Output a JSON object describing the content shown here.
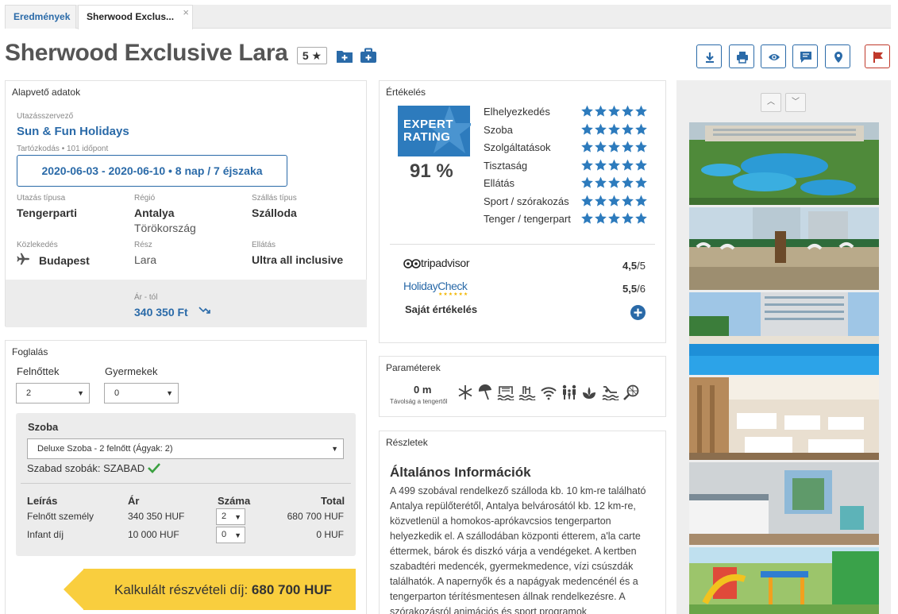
{
  "tabs": [
    {
      "label": "Eredmények",
      "active": false
    },
    {
      "label": "Sherwood Exclus...",
      "active": true,
      "close": "×"
    }
  ],
  "hotel": {
    "name": "Sherwood Exclusive Lara",
    "stars": "5 ★"
  },
  "toolbar": {
    "icons": [
      "download-icon",
      "print-icon",
      "view-icon",
      "comment-icon",
      "location-pin-icon",
      "flag-icon"
    ],
    "accent": "#2a6aa8",
    "flag_color": "#c0392b"
  },
  "basic": {
    "heading": "Alapvető adatok",
    "organizer_label": "Utazásszervező",
    "organizer": "Sun & Fun Holidays",
    "duration_note": "Tartózkodás • 101 időpont",
    "daterange": "2020-06-03 - 2020-06-10 • 8 nap / 7 éjszaka",
    "trip_type_label": "Utazás típusa",
    "trip_type": "Tengerparti",
    "region_label": "Régió",
    "region": "Antalya",
    "country": "Törökország",
    "stay_type_label": "Szállás típus",
    "stay_type": "Szálloda",
    "transport_label": "Közlekedés",
    "transport": "Budapest",
    "part_label": "Rész",
    "part": "Lara",
    "board_label": "Ellátás",
    "board": "Ultra all inclusive",
    "price_label": "Ár - tól",
    "price": "340 350 Ft"
  },
  "booking": {
    "heading": "Foglalás",
    "adults_label": "Felnőttek",
    "adults_value": "2",
    "children_label": "Gyermekek",
    "children_value": "0",
    "room_heading": "Szoba",
    "room_value": "Deluxe Szoba - 2 felnőtt (Ágyak: 2)",
    "free_rooms": "Szabad szobák: SZABAD",
    "table_headers": [
      "Leírás",
      "Ár",
      "Száma",
      "Total"
    ],
    "rows": [
      {
        "desc": "Felnőtt személy",
        "price": "340 350 HUF",
        "qty": "2",
        "total": "680 700 HUF"
      },
      {
        "desc": "Infant díj",
        "price": "10 000 HUF",
        "qty": "0",
        "total": "0 HUF"
      }
    ],
    "calc_label": "Kalkulált részvételi díj:",
    "calc_value": "680 700 HUF"
  },
  "rating": {
    "heading": "Értékelés",
    "expert_line1": "EXPERT",
    "expert_line2": "RATING",
    "percent": "91 %",
    "categories": [
      "Elhelyezkedés",
      "Szoba",
      "Szolgáltatások",
      "Tisztaság",
      "Ellátás",
      "Sport / szórakozás",
      "Tenger / tengerpart"
    ],
    "star_color": "#2d7bbd",
    "tripadvisor_label": "tripadvisor",
    "tripadvisor_score": "4,5",
    "tripadvisor_max": "/5",
    "holidaycheck_label": "HolidayCheck",
    "holidaycheck_score": "5,5",
    "holidaycheck_max": "/6",
    "own_label": "Saját értékelés"
  },
  "params": {
    "heading": "Paraméterek",
    "distance": "0 m",
    "distance_label": "Távolság a tengertől",
    "icons": [
      "air-conditioning-icon",
      "beach-umbrella-icon",
      "pool-icon",
      "indoor-pool-icon",
      "wifi-icon",
      "family-icon",
      "spa-icon",
      "waterslide-icon",
      "tennis-icon"
    ]
  },
  "details": {
    "heading": "Részletek",
    "subheading": "Általános Információk",
    "text": "A 499 szobával rendelkező szálloda kb. 10 km-re található Antalya repülőterétől, Antalya belvárosától kb. 12 km-re, közvetlenül a homokos-aprókavcsios tengerparton helyezkedik el. A szállodában központi étterem, a'la carte éttermek, bárok és diszkó várja a vendégeket. A kertben szabadtéri medencék, gyermekmedence, vízi csúszdák találhatók. A napernyők és a napágyak medencénél és a tengerparton térítésmentesen állnak rendelkezésre. A szórakozásról animációs és sport programok"
  },
  "gallery": {
    "photos": [
      "pool-aerial-photo",
      "beach-photo",
      "pool-photo",
      "restaurant-photo",
      "room-photo",
      "playground-photo"
    ]
  }
}
